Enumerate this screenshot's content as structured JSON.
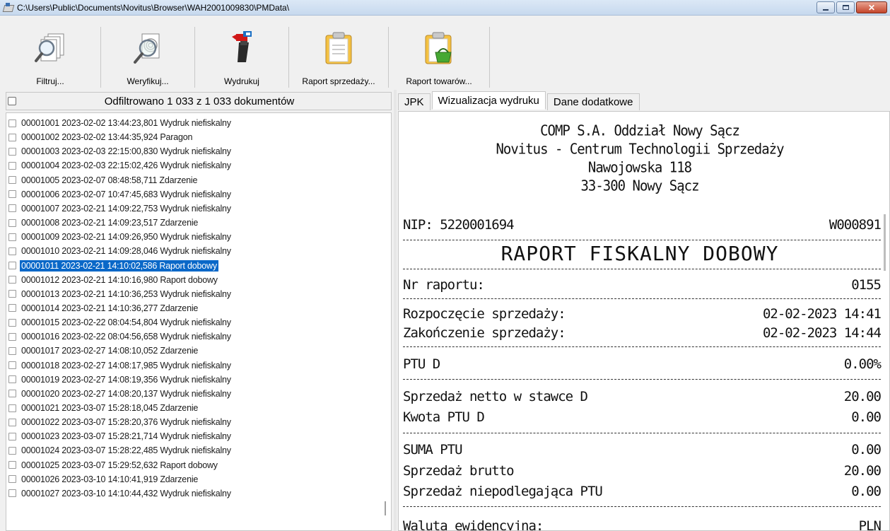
{
  "window": {
    "title": "C:\\Users\\Public\\Documents\\Novitus\\Browser\\WAH2001009830\\PMData\\"
  },
  "toolbar": {
    "filter_label": "Filtruj...",
    "verify_label": "Weryfikuj...",
    "print_label": "Wydrukuj",
    "sales_report_label": "Raport sprzedaży...",
    "goods_report_label": "Raport towarów..."
  },
  "list": {
    "header": "Odfiltrowano 1 033 z 1 033 dokumentów",
    "items": [
      {
        "text": "00001001 2023-02-02 13:44:23,801 Wydruk niefiskalny",
        "selected": false
      },
      {
        "text": "00001002 2023-02-02 13:44:35,924 Paragon",
        "selected": false
      },
      {
        "text": "00001003 2023-02-03 22:15:00,830 Wydruk niefiskalny",
        "selected": false
      },
      {
        "text": "00001004 2023-02-03 22:15:02,426 Wydruk niefiskalny",
        "selected": false
      },
      {
        "text": "00001005 2023-02-07 08:48:58,711 Zdarzenie",
        "selected": false
      },
      {
        "text": "00001006 2023-02-07 10:47:45,683 Wydruk niefiskalny",
        "selected": false
      },
      {
        "text": "00001007 2023-02-21 14:09:22,753 Wydruk niefiskalny",
        "selected": false
      },
      {
        "text": "00001008 2023-02-21 14:09:23,517 Zdarzenie",
        "selected": false
      },
      {
        "text": "00001009 2023-02-21 14:09:26,950 Wydruk niefiskalny",
        "selected": false
      },
      {
        "text": "00001010 2023-02-21 14:09:28,046 Wydruk niefiskalny",
        "selected": false
      },
      {
        "text": "00001011 2023-02-21 14:10:02,586 Raport dobowy",
        "selected": true
      },
      {
        "text": "00001012 2023-02-21 14:10:16,980 Raport dobowy",
        "selected": false
      },
      {
        "text": "00001013 2023-02-21 14:10:36,253 Wydruk niefiskalny",
        "selected": false
      },
      {
        "text": "00001014 2023-02-21 14:10:36,277 Zdarzenie",
        "selected": false
      },
      {
        "text": "00001015 2023-02-22 08:04:54,804 Wydruk niefiskalny",
        "selected": false
      },
      {
        "text": "00001016 2023-02-22 08:04:56,658 Wydruk niefiskalny",
        "selected": false
      },
      {
        "text": "00001017 2023-02-27 14:08:10,052 Zdarzenie",
        "selected": false
      },
      {
        "text": "00001018 2023-02-27 14:08:17,985 Wydruk niefiskalny",
        "selected": false
      },
      {
        "text": "00001019 2023-02-27 14:08:19,356 Wydruk niefiskalny",
        "selected": false
      },
      {
        "text": "00001020 2023-02-27 14:08:20,137 Wydruk niefiskalny",
        "selected": false
      },
      {
        "text": "00001021 2023-03-07 15:28:18,045 Zdarzenie",
        "selected": false
      },
      {
        "text": "00001022 2023-03-07 15:28:20,376 Wydruk niefiskalny",
        "selected": false
      },
      {
        "text": "00001023 2023-03-07 15:28:21,714 Wydruk niefiskalny",
        "selected": false
      },
      {
        "text": "00001024 2023-03-07 15:28:22,485 Wydruk niefiskalny",
        "selected": false
      },
      {
        "text": "00001025 2023-03-07 15:29:52,632 Raport dobowy",
        "selected": false
      },
      {
        "text": "00001026 2023-03-10 14:10:41,919 Zdarzenie",
        "selected": false
      },
      {
        "text": "00001027 2023-03-10 14:10:44,432 Wydruk niefiskalny",
        "selected": false
      }
    ]
  },
  "tabs": {
    "jpk": "JPK",
    "visualization": "Wizualizacja wydruku",
    "additional": "Dane dodatkowe"
  },
  "receipt": {
    "header_lines": [
      "COMP S.A. Oddział Nowy Sącz",
      "Novitus - Centrum Technologii Sprzedaży",
      "Nawojowska 118",
      "33-300 Nowy Sącz"
    ],
    "nip": "NIP: 5220001694",
    "doc_no": "W000891",
    "title": "RAPORT FISKALNY DOBOWY",
    "report_no_label": "Nr raportu:",
    "report_no": "0155",
    "sales_start_label": "Rozpoczęcie sprzedaży:",
    "sales_start": "02-02-2023 14:41",
    "sales_end_label": "Zakończenie sprzedaży:",
    "sales_end": "02-02-2023 14:44",
    "ptu_label": "PTU  D",
    "ptu_value": "0.00%",
    "net_sales_label": "Sprzedaż netto w stawce D",
    "net_sales_value": "20.00",
    "ptu_amount_label": "Kwota PTU D",
    "ptu_amount_value": "0.00",
    "sum_ptu_label": "SUMA PTU",
    "sum_ptu_value": "0.00",
    "gross_label": "Sprzedaż brutto",
    "gross_value": "20.00",
    "exempt_label": "Sprzedaż niepodlegająca PTU",
    "exempt_value": "0.00",
    "currency_label": "Waluta ewidencyjna:",
    "currency_value": "PLN"
  }
}
